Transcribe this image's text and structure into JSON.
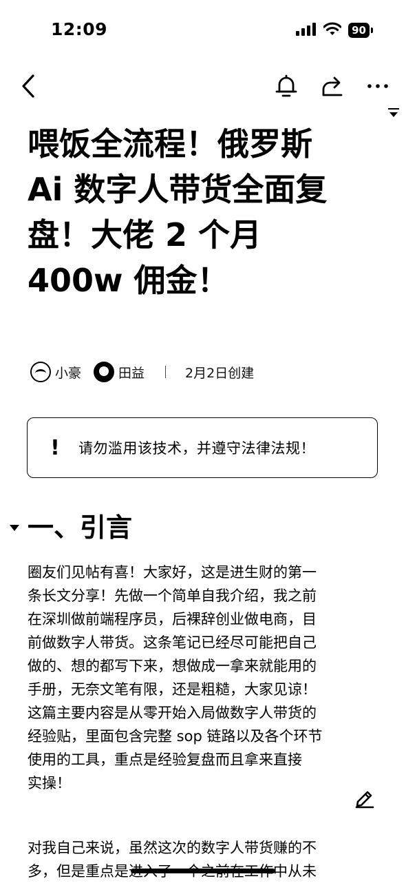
{
  "status_bar": {
    "time": "12:09",
    "battery": "90"
  },
  "nav": {
    "icons": [
      "back-icon",
      "bell-icon",
      "share-icon",
      "more-icon"
    ]
  },
  "title_lines": [
    "喂饭全流程！俄罗斯",
    "Ai 数字人带货全面复",
    "盘！大佬 2 个月",
    "400w 佣金！"
  ],
  "meta": {
    "authors": [
      "小豪",
      "田益"
    ],
    "created": "2月2日创建"
  },
  "callout": {
    "icon": "!",
    "text": "请勿滥用该技术，并遵守法律法规！"
  },
  "section": {
    "heading": "一、引言"
  },
  "paragraph_1": [
    "圈友们见帖有喜！大家好，这是进生财的第一",
    "条长文分享！先做一个简单自我介绍，我之前",
    "在深圳做前端程序员，后裸辞创业做电商，目",
    "前做数字人带货。这条笔记已经尽可能把自己",
    "做的、想的都写下来，想做成一拿来就能用的",
    "手册，无奈文笔有限，还是粗糙，大家见谅！",
    "这篇主要内容是从零开始入局做数字人带货的",
    "经验贴，里面包含完整 sop 链路以及各个环节",
    "使用的工具，重点是经验复盘而且拿来直接",
    "实操！"
  ],
  "paragraph_2": [
    "对我自己来说，虽然这次的数字人带货赚的不",
    "多，但是重点是进入了一个之前在工作中从未"
  ]
}
